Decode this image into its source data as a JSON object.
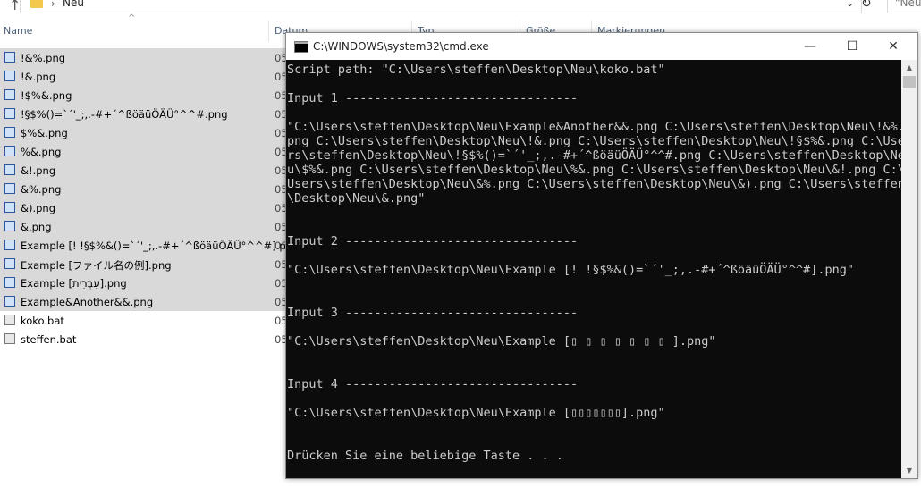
{
  "explorer": {
    "address_path": "Neu",
    "search_placeholder": "\"Neu",
    "columns": {
      "name": "Name",
      "date": "Datum",
      "type": "Typ",
      "size": "Größe",
      "tags": "Markierungen"
    },
    "files": [
      {
        "name": "!&%.png",
        "date": "05",
        "selected": true,
        "kind": "png"
      },
      {
        "name": "!&.png",
        "date": "05",
        "selected": true,
        "kind": "png"
      },
      {
        "name": "!$%&.png",
        "date": "05",
        "selected": true,
        "kind": "png"
      },
      {
        "name": "!§$%()=`´'_;,.-#+´^ßöäüÖÄÜ°^^#.png",
        "date": "05",
        "selected": true,
        "kind": "png"
      },
      {
        "name": "$%&.png",
        "date": "05",
        "selected": true,
        "kind": "png"
      },
      {
        "name": "%&.png",
        "date": "05",
        "selected": true,
        "kind": "png"
      },
      {
        "name": "&!.png",
        "date": "05",
        "selected": true,
        "kind": "png"
      },
      {
        "name": "&%.png",
        "date": "05",
        "selected": true,
        "kind": "png"
      },
      {
        "name": "&).png",
        "date": "05",
        "selected": true,
        "kind": "png"
      },
      {
        "name": "&.png",
        "date": "05",
        "selected": true,
        "kind": "png"
      },
      {
        "name": "Example [! !§$%&()=`´'_;,.-#+´^ßöäüÖÄÜ°^^#].png",
        "date": "05",
        "selected": true,
        "kind": "png"
      },
      {
        "name": "Example [ファイル名の例].png",
        "date": "05",
        "selected": true,
        "kind": "png"
      },
      {
        "name": "Example [עִבְרִית].png",
        "date": "05",
        "selected": true,
        "kind": "png"
      },
      {
        "name": "Example&Another&&.png",
        "date": "05",
        "selected": true,
        "kind": "png"
      },
      {
        "name": "koko.bat",
        "date": "05",
        "selected": false,
        "kind": "bat"
      },
      {
        "name": "steffen.bat",
        "date": "05",
        "selected": false,
        "kind": "bat"
      }
    ]
  },
  "cmd": {
    "title": "C:\\WINDOWS\\system32\\cmd.exe",
    "minimize": "—",
    "maximize": "☐",
    "close": "✕",
    "lines": [
      "Script path: \"C:\\Users\\steffen\\Desktop\\Neu\\koko.bat\"",
      "",
      "Input 1 --------------------------------",
      "",
      "\"C:\\Users\\steffen\\Desktop\\Neu\\Example&Another&&.png C:\\Users\\steffen\\Desktop\\Neu\\!&%.",
      "png C:\\Users\\steffen\\Desktop\\Neu\\!&.png C:\\Users\\steffen\\Desktop\\Neu\\!§$%&.png C:\\Use",
      "rs\\steffen\\Desktop\\Neu\\!§$%()=`´'_;,.-#+´^ßöäüÖÄÜ°^^#.png C:\\Users\\steffen\\Desktop\\Ne",
      "u\\$%&.png C:\\Users\\steffen\\Desktop\\Neu\\%&.png C:\\Users\\steffen\\Desktop\\Neu\\&!.png C:\\",
      "Users\\steffen\\Desktop\\Neu\\&%.png C:\\Users\\steffen\\Desktop\\Neu\\&).png C:\\Users\\steffen",
      "\\Desktop\\Neu\\&.png\"",
      "",
      "",
      "Input 2 --------------------------------",
      "",
      "\"C:\\Users\\steffen\\Desktop\\Neu\\Example [! !§$%&()=`´'_;,.-#+´^ßöäüÖÄÜ°^^#].png\"",
      "",
      "",
      "Input 3 --------------------------------",
      "",
      "\"C:\\Users\\steffen\\Desktop\\Neu\\Example [▯ ▯ ▯ ▯ ▯ ▯ ▯ ].png\"",
      "",
      "",
      "Input 4 --------------------------------",
      "",
      "\"C:\\Users\\steffen\\Desktop\\Neu\\Example [▯▯▯▯▯▯▯].png\"",
      "",
      "",
      "Drücken Sie eine beliebige Taste . . ."
    ]
  }
}
